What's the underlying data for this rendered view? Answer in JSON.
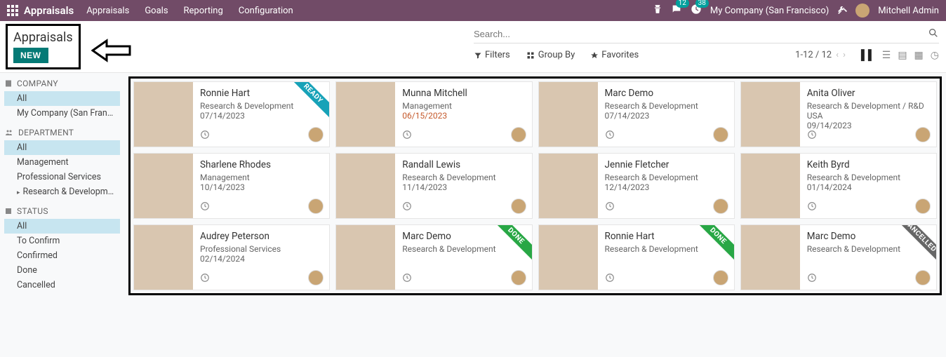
{
  "topnav": {
    "brand": "Appraisals",
    "menu": [
      "Appraisals",
      "Goals",
      "Reporting",
      "Configuration"
    ],
    "chat_badge": "12",
    "activity_badge": "38",
    "company": "My Company (San Francisco)",
    "user": "Mitchell Admin"
  },
  "toolbar": {
    "title": "Appraisals",
    "new_label": "NEW",
    "search_placeholder": "Search...",
    "filters_label": "Filters",
    "group_label": "Group By",
    "favorites_label": "Favorites",
    "pager": "1-12 / 12"
  },
  "sidebar": {
    "sections": [
      {
        "title": "COMPANY",
        "items": [
          {
            "label": "All",
            "selected": true
          },
          {
            "label": "My Company (San Franc..."
          }
        ]
      },
      {
        "title": "DEPARTMENT",
        "items": [
          {
            "label": "All",
            "selected": true
          },
          {
            "label": "Management"
          },
          {
            "label": "Professional Services"
          },
          {
            "label": "Research & Development",
            "expandable": true
          }
        ]
      },
      {
        "title": "STATUS",
        "items": [
          {
            "label": "All",
            "selected": true
          },
          {
            "label": "To Confirm"
          },
          {
            "label": "Confirmed"
          },
          {
            "label": "Done"
          },
          {
            "label": "Cancelled"
          }
        ]
      }
    ]
  },
  "cards": [
    {
      "name": "Ronnie Hart",
      "dept": "Research & Development",
      "date": "07/14/2023",
      "ribbon": "READY",
      "ribbon_cls": "ready",
      "ph": "ph1"
    },
    {
      "name": "Munna Mitchell",
      "dept": "Management",
      "date": "06/15/2023",
      "overdue": true,
      "ph": "ph2"
    },
    {
      "name": "Marc Demo",
      "dept": "Research & Development",
      "date": "07/14/2023",
      "ph": "ph3"
    },
    {
      "name": "Anita Oliver",
      "dept": "Research & Development / R&D USA",
      "date": "09/14/2023",
      "ph": "ph4"
    },
    {
      "name": "Sharlene Rhodes",
      "dept": "Management",
      "date": "10/14/2023",
      "ph": "ph5"
    },
    {
      "name": "Randall Lewis",
      "dept": "Research & Development",
      "date": "11/14/2023",
      "ph": "ph6"
    },
    {
      "name": "Jennie Fletcher",
      "dept": "Research & Development",
      "date": "12/14/2023",
      "ph": "ph7"
    },
    {
      "name": "Keith Byrd",
      "dept": "Research & Development",
      "date": "01/14/2024",
      "ph": "ph8"
    },
    {
      "name": "Audrey Peterson",
      "dept": "Professional Services",
      "date": "02/14/2024",
      "ph": "ph9"
    },
    {
      "name": "Marc Demo",
      "dept": "Research & Development",
      "date": "",
      "ribbon": "DONE",
      "ribbon_cls": "done",
      "ph": "ph10"
    },
    {
      "name": "Ronnie Hart",
      "dept": "Research & Development",
      "date": "",
      "ribbon": "DONE",
      "ribbon_cls": "done",
      "ph": "ph11"
    },
    {
      "name": "Marc Demo",
      "dept": "Research & Development",
      "date": "",
      "ribbon": "CANCELLED",
      "ribbon_cls": "cancelled",
      "ph": "ph12"
    }
  ]
}
